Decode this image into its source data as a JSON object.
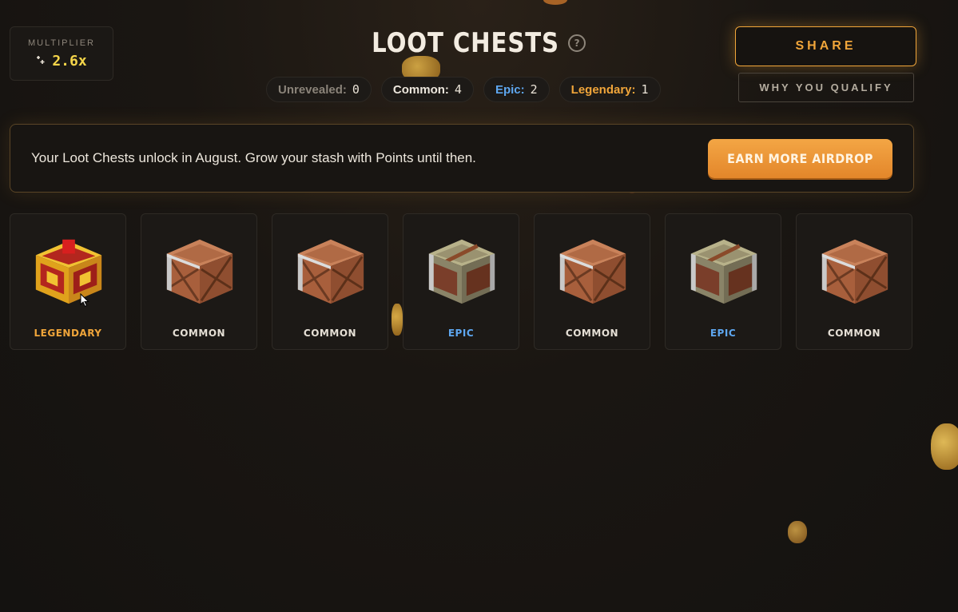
{
  "multiplier": {
    "label": "MULTIPLIER",
    "value": "2.6x",
    "icon": "sparkle-icon"
  },
  "header": {
    "title": "LOOT CHESTS",
    "help_icon": "question-icon"
  },
  "counts": [
    {
      "label": "Unrevealed:",
      "value": "0",
      "kind": "unrevealed"
    },
    {
      "label": "Common:",
      "value": "4",
      "kind": "common"
    },
    {
      "label": "Epic:",
      "value": "2",
      "kind": "epic"
    },
    {
      "label": "Legendary:",
      "value": "1",
      "kind": "legendary"
    }
  ],
  "actions": {
    "share_label": "SHARE",
    "why_label": "WHY YOU QUALIFY"
  },
  "banner": {
    "text": "Your Loot Chests unlock in August. Grow your stash with Points until then.",
    "button_label": "EARN MORE AIRDROP"
  },
  "chests": [
    {
      "rarity": "LEGENDARY",
      "kind": "legendary"
    },
    {
      "rarity": "COMMON",
      "kind": "common"
    },
    {
      "rarity": "COMMON",
      "kind": "common"
    },
    {
      "rarity": "EPIC",
      "kind": "epic"
    },
    {
      "rarity": "COMMON",
      "kind": "common"
    },
    {
      "rarity": "EPIC",
      "kind": "epic"
    },
    {
      "rarity": "COMMON",
      "kind": "common"
    }
  ],
  "colors": {
    "accent": "#f0a53a",
    "epic": "#5ea7f0",
    "legendary": "#f0a53a",
    "multiplier": "#f5d54a"
  }
}
